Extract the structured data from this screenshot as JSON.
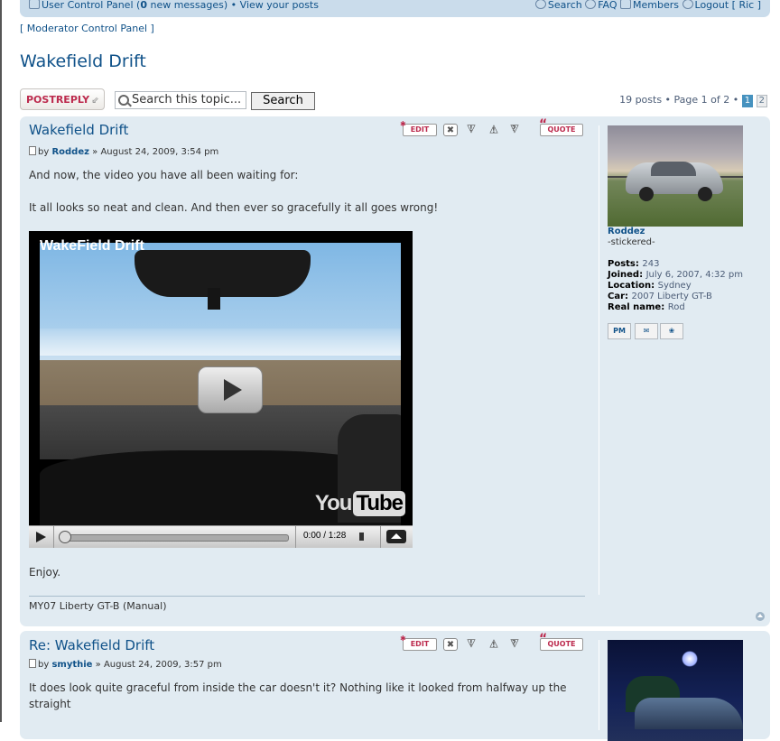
{
  "navbar": {
    "ucp": "User Control Panel",
    "new_msgs_count": "0",
    "new_msgs_label": "new messages",
    "view_posts": "View your posts",
    "search": "Search",
    "faq": "FAQ",
    "members": "Members",
    "logout": "Logout [ Ric ]"
  },
  "modcp": "[ Moderator Control Panel ]",
  "topic_title": "Wakefield Drift",
  "actions": {
    "post_reply": "POSTREPLY",
    "search_value": "Search this topic...",
    "search_button": "Search",
    "pagination_text": "19 posts • Page 1 of 2 •",
    "page_current": "1",
    "page_next": "2"
  },
  "post_buttons": {
    "edit": "EDIT",
    "delete": "✖",
    "report": "!",
    "warn": "!",
    "info": "?",
    "quote": "QUOTE"
  },
  "posts": [
    {
      "title": "Wakefield Drift",
      "by": "by",
      "author": "Roddez",
      "date": "» August 24, 2009, 3:54 pm",
      "text1": "And now, the video you have all been waiting for:",
      "text2": "It all looks so neat and clean. And then ever so gracefully it all goes wrong!",
      "video": {
        "title": "WakeField Drift",
        "time": "0:00 / 1:28",
        "brand_you": "You",
        "brand_tube": "Tube"
      },
      "text3": "Enjoy.",
      "signature": "MY07 Liberty GT-B (Manual)",
      "profile": {
        "username": "Roddez",
        "rank": "-stickered-",
        "posts_label": "Posts:",
        "posts": "243",
        "joined_label": "Joined:",
        "joined": "July 6, 2007, 4:32 pm",
        "location_label": "Location:",
        "location": "Sydney",
        "car_label": "Car:",
        "car": "2007 Liberty GT-B",
        "realname_label": "Real name:",
        "realname": "Rod",
        "pm": "PM"
      }
    },
    {
      "title": "Re: Wakefield Drift",
      "by": "by",
      "author": "smythie",
      "date": "» August 24, 2009, 3:57 pm",
      "text1": "It does look quite graceful from inside the car doesn't it? Nothing like it looked from halfway up the",
      "text2": "straight"
    }
  ],
  "colors": {
    "link": "#105289",
    "post_bg": "#e1ebf2",
    "navbar_bg": "#cadceb",
    "accent_red": "#bc2a4d"
  }
}
